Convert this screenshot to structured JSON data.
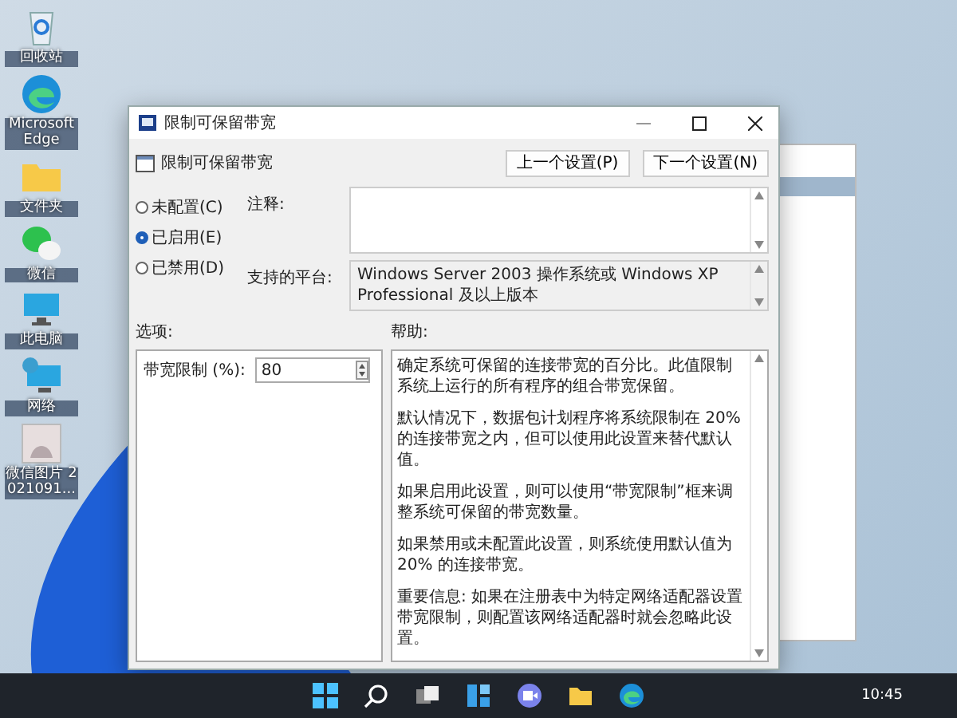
{
  "desktop_icons": [
    {
      "kind": "recycle",
      "label": "回收站"
    },
    {
      "kind": "edge",
      "label": "Microsoft Edge"
    },
    {
      "kind": "folder",
      "label": "文件夹"
    },
    {
      "kind": "wechat",
      "label": "微信"
    },
    {
      "kind": "pc",
      "label": "此电脑"
    },
    {
      "kind": "network",
      "label": "网络"
    },
    {
      "kind": "image",
      "label": "微信图片 2021091..."
    }
  ],
  "dialog": {
    "title": "限制可保留带宽",
    "setting_name": "限制可保留带宽",
    "nav_buttons": [
      "上一个设置(P)",
      "下一个设置(N)"
    ],
    "states": [
      {
        "label": "未配置(C)",
        "selected": false
      },
      {
        "label": "已启用(E)",
        "selected": true
      },
      {
        "label": "已禁用(D)",
        "selected": false
      }
    ],
    "comment_label": "注释:",
    "platform_label": "支持的平台:",
    "platform": "Windows Server 2003 操作系统或 Windows XP Professional 及以上版本",
    "options_label": "选项:",
    "help_label": "帮助:",
    "options": [
      {
        "label": "带宽限制 (%):",
        "value": "80"
      }
    ],
    "help": [
      "确定系统可保留的连接带宽的百分比。此值限制系统上运行的所有程序的组合带宽保留。",
      "默认情况下，数据包计划程序将系统限制在 20% 的连接带宽之内，但可以使用此设置来替代默认值。",
      "如果启用此设置，则可以使用“带宽限制”框来调整系统可保留的带宽数量。",
      "如果禁用或未配置此设置，则系统使用默认值为 20% 的连接带宽。",
      "重要信息: 如果在注册表中为特定网络适配器设置带宽限制，则配置该网络适配器时就会忽略此设置。"
    ]
  },
  "taskbar": {
    "apps": [
      {
        "kind": "start"
      },
      {
        "kind": "search"
      },
      {
        "kind": "taskview"
      },
      {
        "kind": "widgets"
      },
      {
        "kind": "chat"
      },
      {
        "kind": "explorer"
      },
      {
        "kind": "edge"
      }
    ],
    "clock": "10:45"
  }
}
